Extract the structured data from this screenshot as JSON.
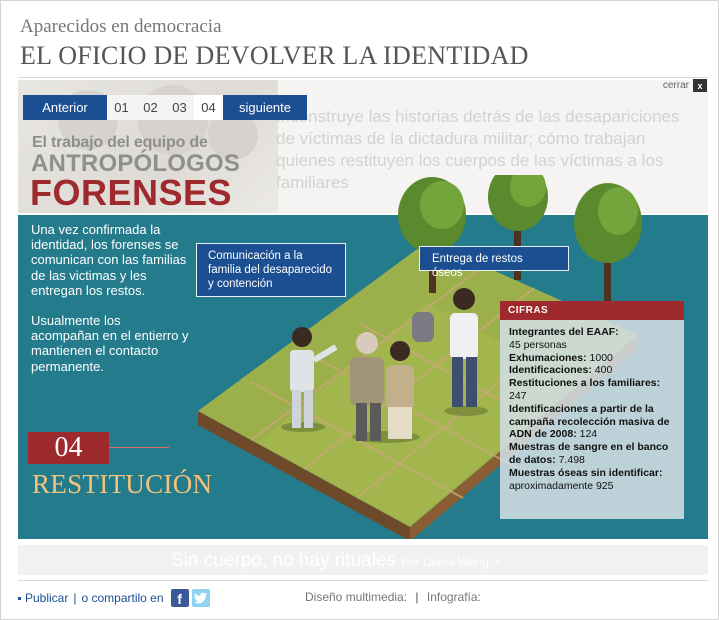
{
  "header": {
    "kicker": "Aparecidos en democracia",
    "title": "EL OFICIO DE DEVOLVER LA IDENTIDAD",
    "close_label": "cerrar",
    "close_icon": "x"
  },
  "background": {
    "faded_text": "...construye las historias detrás de las desapariciones de víctimas de la dictadura militar; cómo trabajan quienes restituyen los cuerpos de las víctimas a los familiares"
  },
  "pager": {
    "prev_label": "Anterior",
    "next_label": "siguiente",
    "pages": [
      "01",
      "02",
      "03",
      "04"
    ],
    "active_page": "04"
  },
  "section": {
    "line1": "El trabajo del equipo de",
    "line2": "ANTROPÓLOGOS",
    "line3": "FORENSES"
  },
  "panel": {
    "paragraph1": "Una vez confirmada la identidad, los forenses se comunican con las familias de las victimas y les entregan los restos.",
    "paragraph2": "Usualmente los acompañan en el entierro y mantienen el contacto permanente.",
    "step_number": "04",
    "step_title": "RESTITUCIÓN"
  },
  "bubbles": {
    "communication": "Comunicación a la familia del desaparecido y contención",
    "delivery": "Entrega de restos óseos"
  },
  "cifras": {
    "title": "CIFRAS",
    "items": [
      {
        "label": "Integrantes del EAAF:",
        "value": "45 personas"
      },
      {
        "label": "Exhumaciones:",
        "value": "1000"
      },
      {
        "label": "Identificaciones:",
        "value": "400"
      },
      {
        "label": "Restituciones a los familiares:",
        "value": "247"
      },
      {
        "label": "Identificaciones a partir de la campaña recolección masiva de ADN de 2008:",
        "value": "124"
      },
      {
        "label": "Muestras de sangre en el banco de datos:",
        "value": "7.498"
      },
      {
        "label": "Muestras óseas sin identificar:",
        "value": "aproximadamente 925"
      }
    ]
  },
  "footer": {
    "ghost_title": "Sin cuerpo, no hay rituales",
    "ghost_byline": "Por Diana Wang",
    "ghost_arrow": "»",
    "share_label": "Publicar",
    "share_sep": "|",
    "share_text": "o compartilo en",
    "facebook_glyph": "f",
    "design_label": "Diseño multimedia:",
    "credits_sep": "|",
    "infographic_label": "Infografía:"
  },
  "colors": {
    "accent_blue": "#1b4f91",
    "panel_teal": "#237b8c",
    "accent_red": "#9e2a2e",
    "title_gold": "#f4c37a"
  }
}
